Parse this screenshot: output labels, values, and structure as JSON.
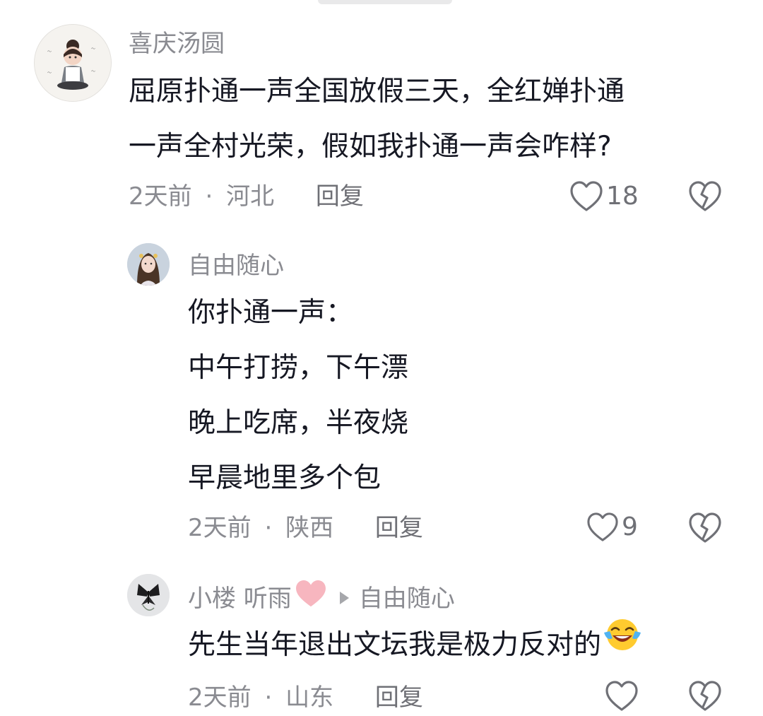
{
  "comments": [
    {
      "username": "喜庆汤圆",
      "lines": [
        "屈原扑通一声全国放假三天，全红婵扑通",
        "一声全村光荣，假如我扑通一声会咋样?"
      ],
      "time": "2天前",
      "location": "河北",
      "reply_label": "回复",
      "likes": "18"
    },
    {
      "username": "自由随心",
      "lines": [
        "你扑通一声：",
        "中午打捞，下午漂",
        "晚上吃席，半夜烧",
        "早晨地里多个包"
      ],
      "time": "2天前",
      "location": "陕西",
      "reply_label": "回复",
      "likes": "9"
    },
    {
      "username": "小楼 听雨",
      "reply_to": "自由随心",
      "lines": [
        "先生当年退出文坛我是极力反对的"
      ],
      "time": "2天前",
      "location": "山东",
      "reply_label": "回复",
      "likes": ""
    }
  ],
  "meta_separator": "·",
  "icons": {
    "like": "heart-outline-icon",
    "dislike": "broken-heart-icon",
    "reply_arrow": "play-arrow-icon",
    "heart_emoji": "pink-heart-emoji",
    "laugh_emoji": "laughing-crying-emoji"
  },
  "colors": {
    "text": "#161823",
    "secondary": "#8a8b91",
    "icon": "#6f7076",
    "pink_heart": "#f7b6bf",
    "emoji_yellow": "#ffcb2f"
  }
}
